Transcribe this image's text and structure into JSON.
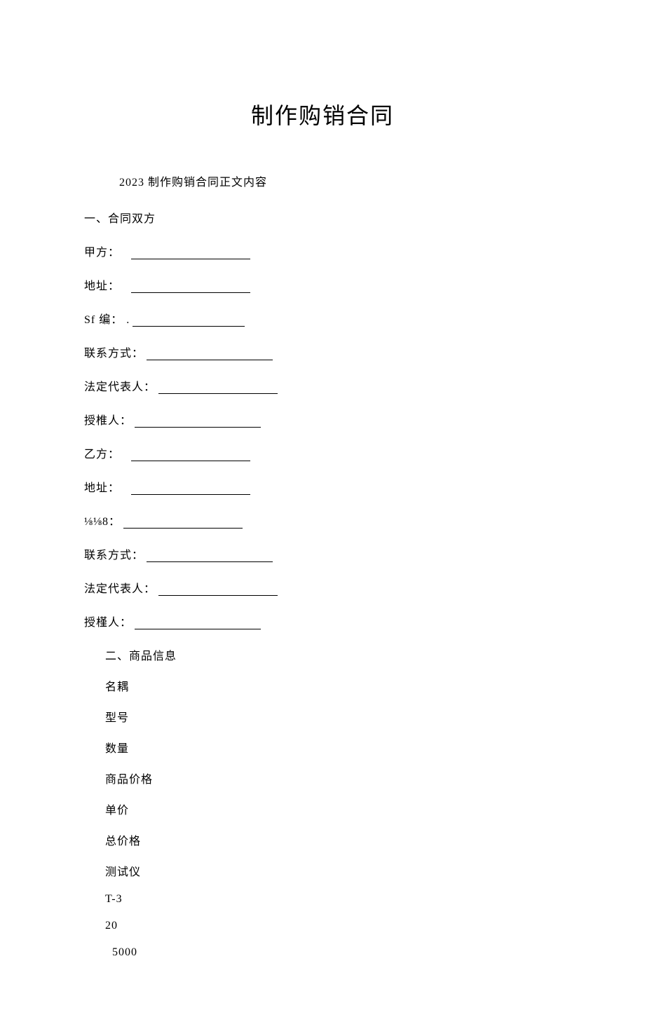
{
  "title": "制作购销合同",
  "subtitle": "2023 制作购销合同正文内容",
  "section1": {
    "heading": "一、合同双方",
    "partyA": {
      "name_label": "甲方：",
      "address_label": "地址：",
      "sf_label": "Sf 编： .",
      "contact_label": "联系方式：",
      "legal_rep_label": "法定代表人：",
      "authorizer_label": "授椎人："
    },
    "partyB": {
      "name_label": "乙方：",
      "address_label": "地址：",
      "code_label": "⅛⅛8：",
      "contact_label": "联系方式：",
      "legal_rep_label": "法定代表人：",
      "authorizer_label": "授槿人："
    }
  },
  "section2": {
    "heading": "二、商品信息",
    "rows": {
      "name_label": "名耦",
      "model_label": "型号",
      "qty_label": "数量",
      "price_label": "商品价格",
      "unit_price_label": "单价",
      "total_price_label": "总价格",
      "product_name": "测试仪",
      "product_model": "T-3",
      "product_qty": "20",
      "product_price": "5000"
    }
  }
}
